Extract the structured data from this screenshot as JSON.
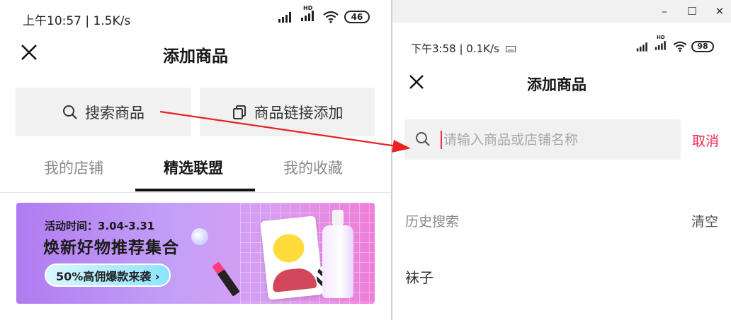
{
  "left_phone": {
    "status": {
      "time_speed": "上午10:57 | 1.5K/s",
      "hd_label": "HD",
      "battery": "46"
    },
    "header": {
      "title": "添加商品"
    },
    "buttons": {
      "search_label": "搜索商品",
      "link_label": "商品链接添加"
    },
    "tabs": [
      {
        "label": "我的店铺",
        "active": false
      },
      {
        "label": "精选联盟",
        "active": true
      },
      {
        "label": "我的收藏",
        "active": false
      }
    ],
    "banner": {
      "date": "活动时间：3.04-3.31",
      "headline": "焕新好物推荐集合",
      "pill": "50%高佣爆款来袭 ›"
    }
  },
  "right_window": {
    "titlebar": {
      "minimize": "–",
      "maximize": "☐",
      "close": "✕"
    },
    "status": {
      "time_speed": "下午3:58 | 0.1K/s",
      "hd_label": "HD",
      "battery": "98"
    },
    "header": {
      "title": "添加商品"
    },
    "search": {
      "placeholder": "请输入商品或店铺名称",
      "value": ""
    },
    "cancel_label": "取消",
    "history": {
      "title": "历史搜索",
      "clear_label": "清空",
      "items": [
        "袜子"
      ]
    }
  },
  "colors": {
    "accent_red": "#f0254b",
    "annotation_arrow": "#e82222",
    "search_bg": "#f1f1f1"
  },
  "icons": [
    "signal-icon",
    "wifi-icon",
    "battery-icon",
    "close-icon",
    "search-icon",
    "copy-icon",
    "keyboard-icon",
    "arrow-annotation"
  ]
}
